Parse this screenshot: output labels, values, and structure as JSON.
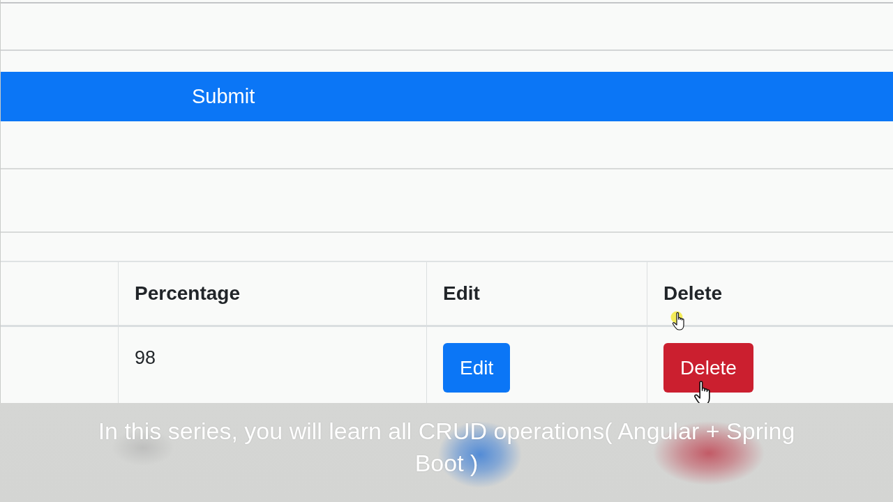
{
  "submit_button": {
    "label": "Submit"
  },
  "table": {
    "columns": [
      "Percentage",
      "Edit",
      "Delete"
    ],
    "rows": [
      {
        "percentage": "98",
        "edit_button": "Edit",
        "delete_button": "Delete"
      }
    ]
  },
  "caption": {
    "text": "In this series, you will learn all CRUD operations( Angular + Spring Boot )"
  }
}
